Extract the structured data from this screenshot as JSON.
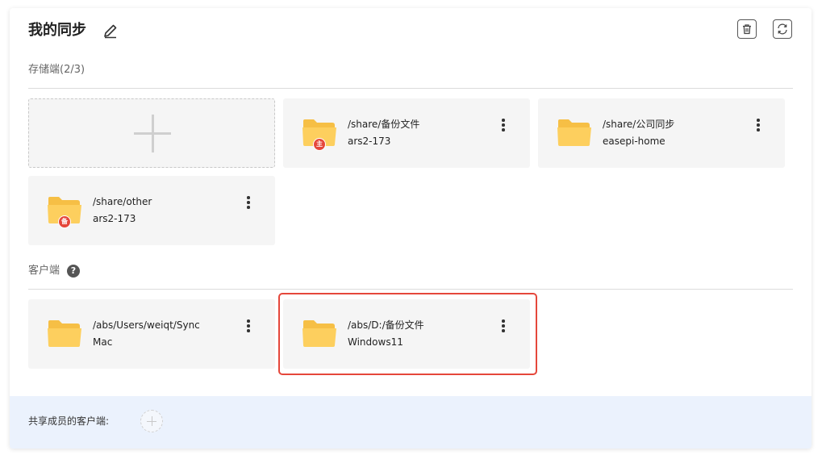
{
  "header": {
    "title": "我的同步",
    "edit_icon": "pencil-icon",
    "delete_icon": "trash-icon",
    "refresh_icon": "refresh-icon"
  },
  "storage": {
    "label": "存储端(2/3)",
    "add_icon": "plus-icon",
    "items": [
      {
        "path": "/share/备份文件",
        "host": "ars2-173",
        "badge": "主",
        "icon": "folder-icon"
      },
      {
        "path": "/share/公司同步",
        "host": "easepi-home",
        "badge": "",
        "icon": "folder-icon"
      },
      {
        "path": "/share/other",
        "host": "ars2-173",
        "badge": "备",
        "icon": "folder-icon"
      }
    ]
  },
  "clients": {
    "label": "客户端",
    "help_icon": "question-icon",
    "items": [
      {
        "path": "/abs/Users/weiqt/Sync",
        "host": "Mac",
        "icon": "folder-icon"
      },
      {
        "path": "/abs/D:/备份文件",
        "host": "Windows11",
        "icon": "folder-icon"
      }
    ]
  },
  "footer": {
    "label": "共享成员的客户端:",
    "add_icon": "plus-icon"
  },
  "colors": {
    "folder": "#fdcf5e",
    "folder_back": "#f6bf45",
    "badge": "#e5473b",
    "highlight": "#e5473b",
    "footer_bg": "#ebf2fd",
    "card_bg": "#f5f5f5"
  }
}
